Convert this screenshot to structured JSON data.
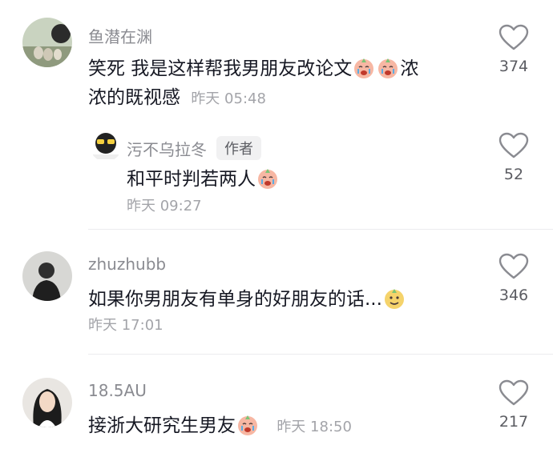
{
  "comments": [
    {
      "username": "鱼潜在渊",
      "text_line1": "笑死 我是这样帮我男朋友改论文",
      "text_line1_tail": "浓",
      "text_line2": "浓的既视感",
      "time": "昨天 05:48",
      "likes": "374",
      "avatar_icon": "duck-photo-avatar"
    },
    {
      "username": "污不乌拉冬",
      "author_badge": "作者",
      "text": "和平时判若两人",
      "time": "昨天 09:27",
      "likes": "52",
      "avatar_icon": "sunglasses-sticker-avatar"
    },
    {
      "username": "zhuzhubb",
      "text": "如果你男朋友有单身的好朋友的话...",
      "time": "昨天 17:01",
      "likes": "346",
      "avatar_icon": "person-photo-avatar"
    },
    {
      "username": "18.5AU",
      "text": "接浙大研究生男友",
      "time": "昨天 18:50",
      "likes": "217",
      "avatar_icon": "portrait-photo-avatar"
    }
  ],
  "colors": {
    "username": "#8a8b91",
    "text": "#161823",
    "time": "#a3a4a9",
    "divider": "#ececee"
  }
}
